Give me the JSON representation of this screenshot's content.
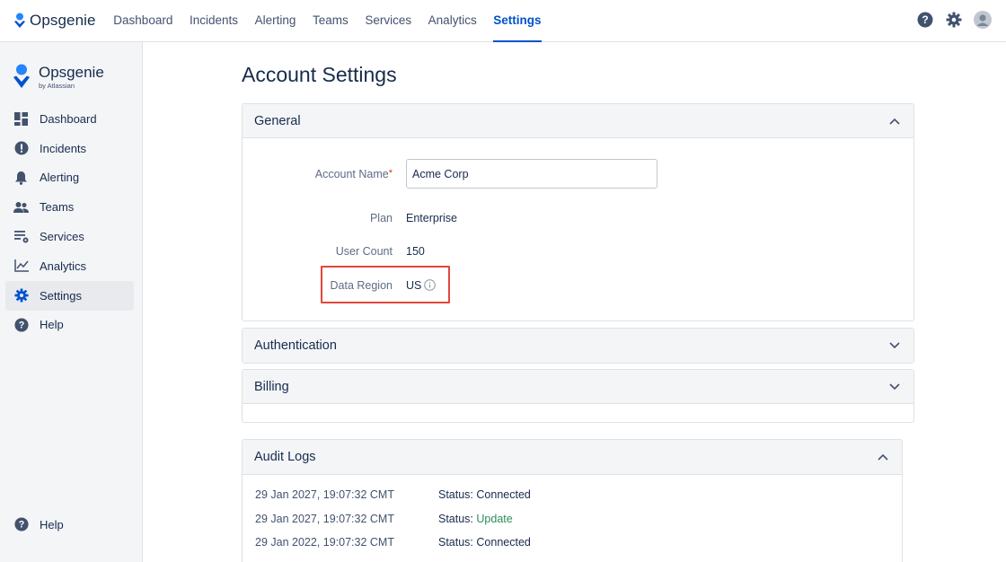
{
  "topbar": {
    "brand": "Opsgenie",
    "nav": [
      {
        "label": "Dashboard",
        "active": false
      },
      {
        "label": "Incidents",
        "active": false
      },
      {
        "label": "Alerting",
        "active": false
      },
      {
        "label": "Teams",
        "active": false
      },
      {
        "label": "Services",
        "active": false
      },
      {
        "label": "Analytics",
        "active": false
      },
      {
        "label": "Settings",
        "active": true
      }
    ],
    "icons": [
      "help-icon",
      "gear-icon",
      "avatar"
    ]
  },
  "sidebar": {
    "brand_title": "Opsgenie",
    "brand_sub": "by Atlassian",
    "items": [
      {
        "label": "Dashboard",
        "icon": "dashboard-icon"
      },
      {
        "label": "Incidents",
        "icon": "alert-circle-icon"
      },
      {
        "label": "Alerting",
        "icon": "bell-icon"
      },
      {
        "label": "Teams",
        "icon": "people-icon"
      },
      {
        "label": "Services",
        "icon": "services-icon"
      },
      {
        "label": "Analytics",
        "icon": "chart-icon"
      },
      {
        "label": "Settings",
        "icon": "gear-icon",
        "active": true
      },
      {
        "label": "Help",
        "icon": "help-icon"
      }
    ],
    "bottom_help": "Help"
  },
  "page": {
    "title": "Account Settings"
  },
  "general": {
    "title": "General",
    "account_name_label": "Account Name",
    "account_name_value": "Acme Corp",
    "plan_label": "Plan",
    "plan_value": "Enterprise",
    "user_count_label": "User Count",
    "user_count_value": "150",
    "data_region_label": "Data Region",
    "data_region_value": "US"
  },
  "authentication": {
    "title": "Authentication"
  },
  "billing": {
    "title": "Billing"
  },
  "audit": {
    "title": "Audit Logs",
    "rows": [
      {
        "time": "29 Jan 2027, 19:07:32 CMT",
        "status_prefix": "Status:",
        "status": "Connected",
        "is_link": false
      },
      {
        "time": "29 Jan 2027, 19:07:32 CMT",
        "status_prefix": "Status:",
        "status": "Update",
        "is_link": true
      },
      {
        "time": "29 Jan 2022, 19:07:32 CMT",
        "status_prefix": "Status:",
        "status": "Connected",
        "is_link": false
      }
    ]
  },
  "colors": {
    "accent": "#0052cc",
    "highlight_border": "#e0473a",
    "link_green": "#2c8c5b",
    "required": "#de350b"
  }
}
